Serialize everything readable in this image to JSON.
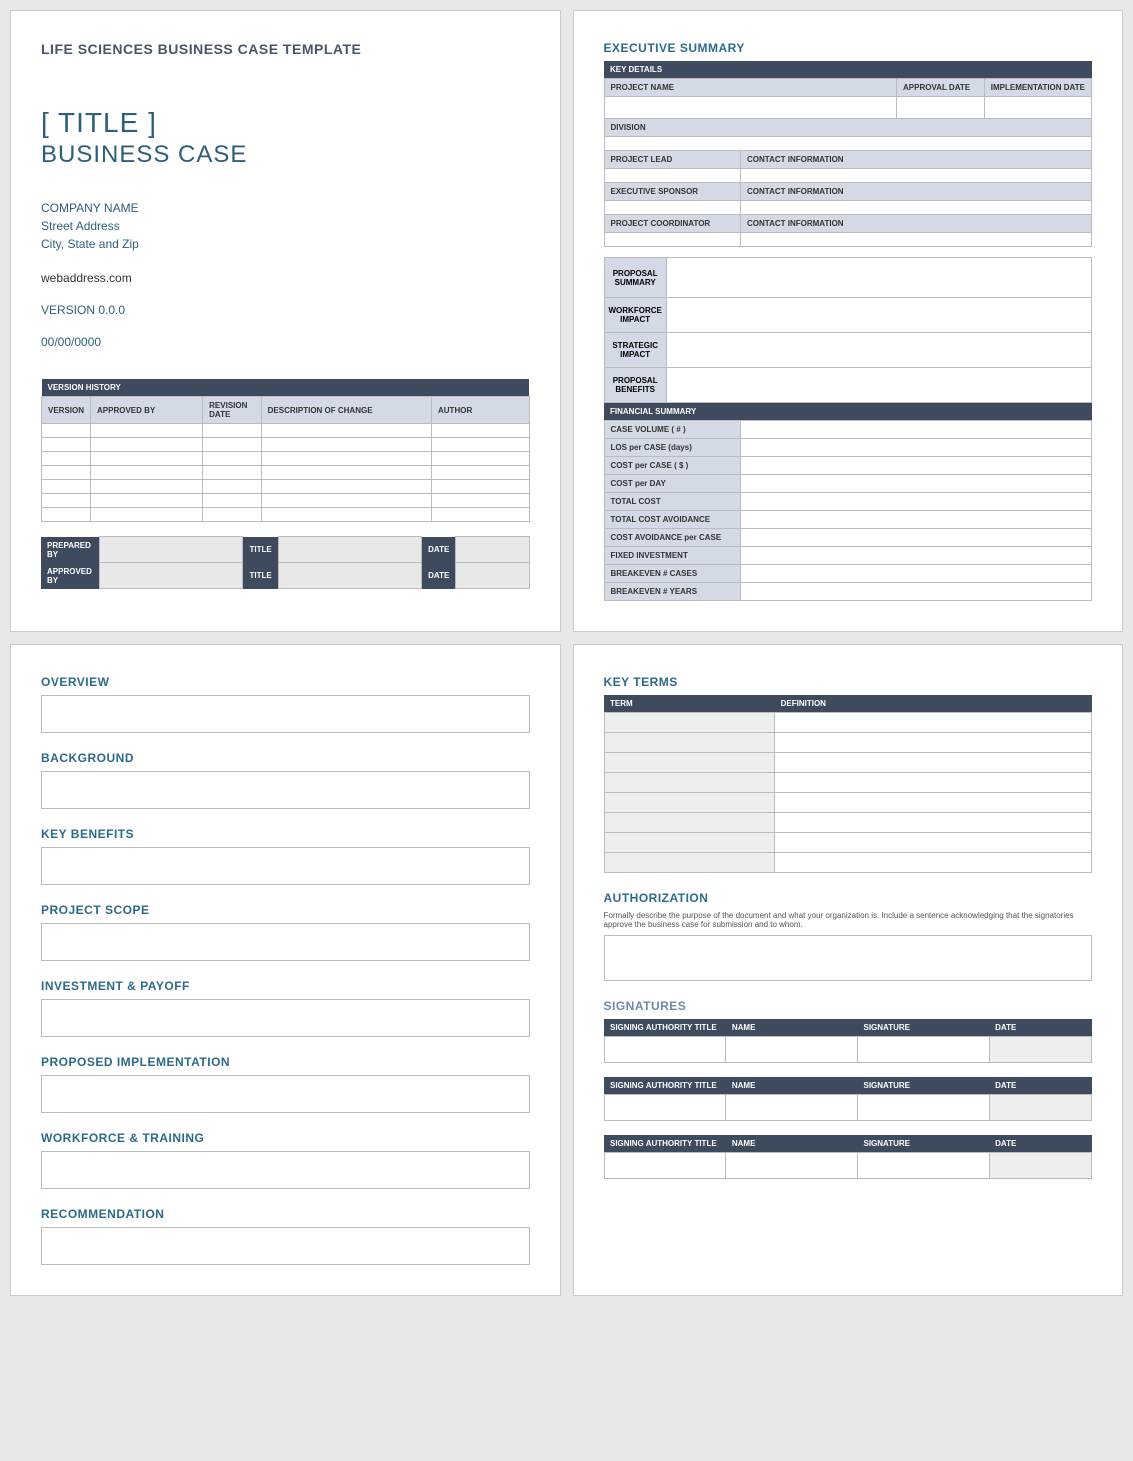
{
  "doc_header": "LIFE SCIENCES BUSINESS CASE TEMPLATE",
  "title": {
    "main": "[ TITLE ]",
    "sub": "BUSINESS CASE"
  },
  "company": {
    "name": "COMPANY NAME",
    "street": "Street Address",
    "city": "City, State and Zip"
  },
  "web": "webaddress.com",
  "version": "VERSION 0.0.0",
  "date": "00/00/0000",
  "version_history": {
    "title": "VERSION HISTORY",
    "cols": {
      "version": "VERSION",
      "approved": "APPROVED BY",
      "revdate": "REVISION DATE",
      "desc": "DESCRIPTION OF CHANGE",
      "author": "AUTHOR"
    }
  },
  "approval": {
    "prepared": "PREPARED BY",
    "approved": "APPROVED BY",
    "title": "TITLE",
    "date": "DATE"
  },
  "exec": {
    "heading": "EXECUTIVE SUMMARY",
    "key_details": "KEY DETAILS",
    "project_name": "PROJECT NAME",
    "approval_date": "APPROVAL DATE",
    "impl_date": "IMPLEMENTATION DATE",
    "division": "DIVISION",
    "project_lead": "PROJECT LEAD",
    "contact_info": "CONTACT INFORMATION",
    "exec_sponsor": "EXECUTIVE SPONSOR",
    "proj_coord": "PROJECT COORDINATOR",
    "prop_summary": "PROPOSAL SUMMARY",
    "workforce": "WORKFORCE IMPACT",
    "strategic": "STRATEGIC IMPACT",
    "benefits": "PROPOSAL BENEFITS",
    "fin_summary": "FINANCIAL SUMMARY",
    "case_vol": "CASE VOLUME ( # )",
    "los": "LOS per CASE (days)",
    "cost_case": "COST per CASE ( $ )",
    "cost_day": "COST per DAY",
    "total_cost": "TOTAL COST",
    "tca": "TOTAL COST AVOIDANCE",
    "ca_case": "COST AVOIDANCE per CASE",
    "fixed": "FIXED INVESTMENT",
    "be_cases": "BREAKEVEN # CASES",
    "be_years": "BREAKEVEN # YEARS"
  },
  "sections": {
    "overview": "OVERVIEW",
    "background": "BACKGROUND",
    "benefits": "KEY BENEFITS",
    "scope": "PROJECT SCOPE",
    "invest": "INVESTMENT & PAYOFF",
    "impl": "PROPOSED IMPLEMENTATION",
    "workforce": "WORKFORCE & TRAINING",
    "rec": "RECOMMENDATION"
  },
  "key_terms": {
    "heading": "KEY TERMS",
    "term": "TERM",
    "def": "DEFINITION"
  },
  "auth": {
    "heading": "AUTHORIZATION",
    "desc": "Formally describe the purpose of the document and what your organization is. Include a sentence acknowledging that the signatories approve the business case for submission and to whom."
  },
  "sig": {
    "heading": "SIGNATURES",
    "auth_title": "SIGNING AUTHORITY TITLE",
    "name": "NAME",
    "signature": "SIGNATURE",
    "date": "DATE"
  }
}
